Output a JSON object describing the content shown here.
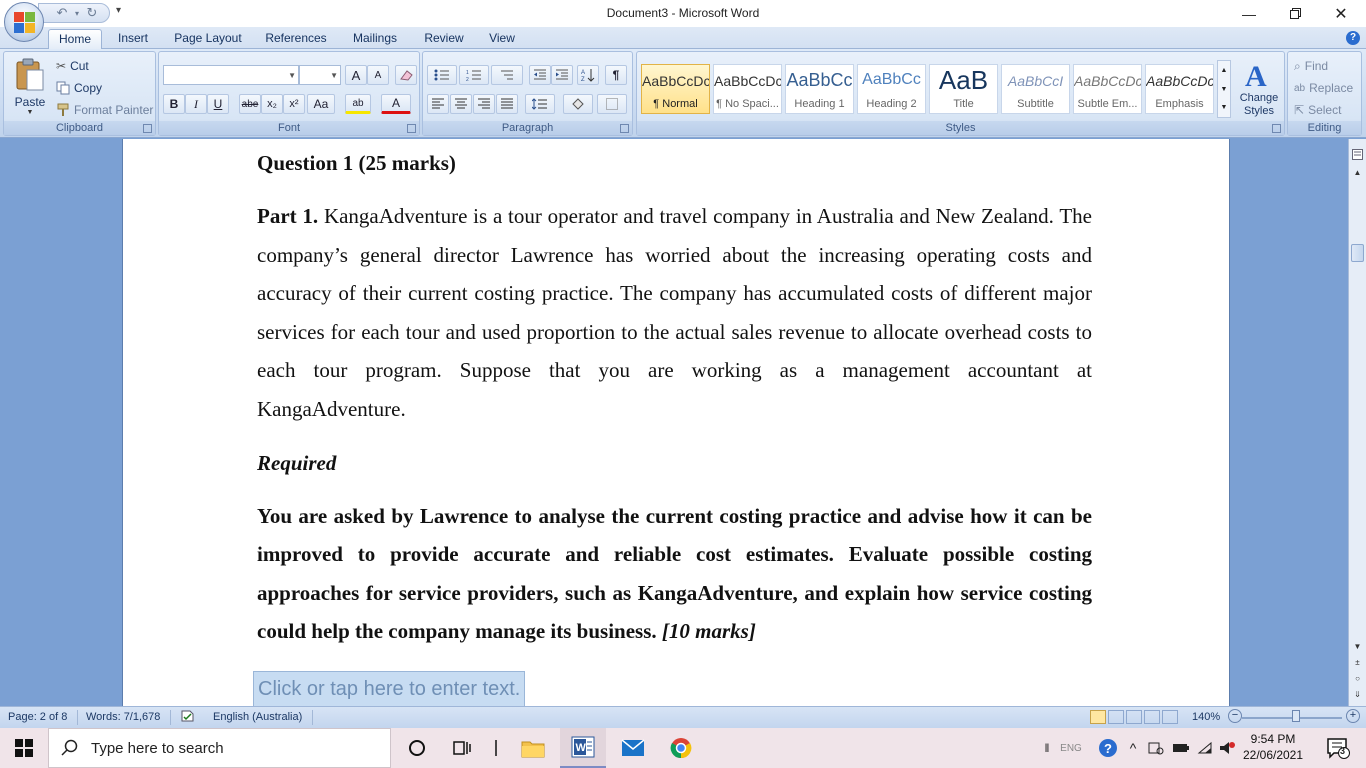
{
  "window": {
    "title": "Document3 - Microsoft Word"
  },
  "qat": {
    "undo": "↶",
    "redo": "↻"
  },
  "tabs": [
    "Home",
    "Insert",
    "Page Layout",
    "References",
    "Mailings",
    "Review",
    "View"
  ],
  "clipboard": {
    "paste": "Paste",
    "cut": "Cut",
    "copy": "Copy",
    "format_painter": "Format Painter",
    "label": "Clipboard"
  },
  "font": {
    "label": "Font",
    "bold": "B",
    "italic": "I",
    "underline": "U",
    "strike": "abe",
    "sub": "x₂",
    "sup": "x²",
    "case": "Aa",
    "grow": "A",
    "shrink": "A",
    "highlight": "ab",
    "color": "A"
  },
  "paragraph": {
    "label": "Paragraph",
    "pilcrow": "¶"
  },
  "styles": {
    "label": "Styles",
    "items": [
      {
        "sample": "AaBbCcDc",
        "name": "¶ Normal"
      },
      {
        "sample": "AaBbCcDc",
        "name": "¶ No Spaci..."
      },
      {
        "sample": "AaBbCc",
        "name": "Heading 1"
      },
      {
        "sample": "AaBbCc",
        "name": "Heading 2"
      },
      {
        "sample": "AaB",
        "name": "Title"
      },
      {
        "sample": "AaBbCcI",
        "name": "Subtitle"
      },
      {
        "sample": "AaBbCcDc",
        "name": "Subtle Em..."
      },
      {
        "sample": "AaBbCcDc",
        "name": "Emphasis"
      }
    ],
    "change": "Change Styles"
  },
  "editing": {
    "label": "Editing",
    "find": "Find",
    "replace": "Replace",
    "select": "Select"
  },
  "document": {
    "question_title": "Question 1 (25 marks)",
    "part_label": "Part 1.",
    "part_text": " KangaAdventure is a tour operator and travel company in Australia and New Zealand. The company’s general director Lawrence has worried about the increasing operating costs and accuracy of their current costing practice. The company has accumulated costs of different major services for each tour and used proportion to the actual sales revenue to allocate overhead costs to each tour program. Suppose that you are working as a management accountant at KangaAdventure.",
    "required": "Required",
    "task_text": "You are asked by Lawrence to analyse the current costing practice and advise how it can be improved to provide accurate and reliable cost estimates. Evaluate possible costing approaches for service providers, such as KangaAdventure, and explain how service costing could help the company manage its business. ",
    "task_marks": "[10 marks]",
    "placeholder": "Click or tap here to enter text."
  },
  "status": {
    "page": "Page: 2 of 8",
    "words": "Words: 7/1,678",
    "language": "English (Australia)",
    "zoom": "140%"
  },
  "taskbar": {
    "search_placeholder": "Type here to search",
    "lang": "ENG",
    "time": "9:54 PM",
    "date": "22/06/2021",
    "notifications": "3"
  }
}
